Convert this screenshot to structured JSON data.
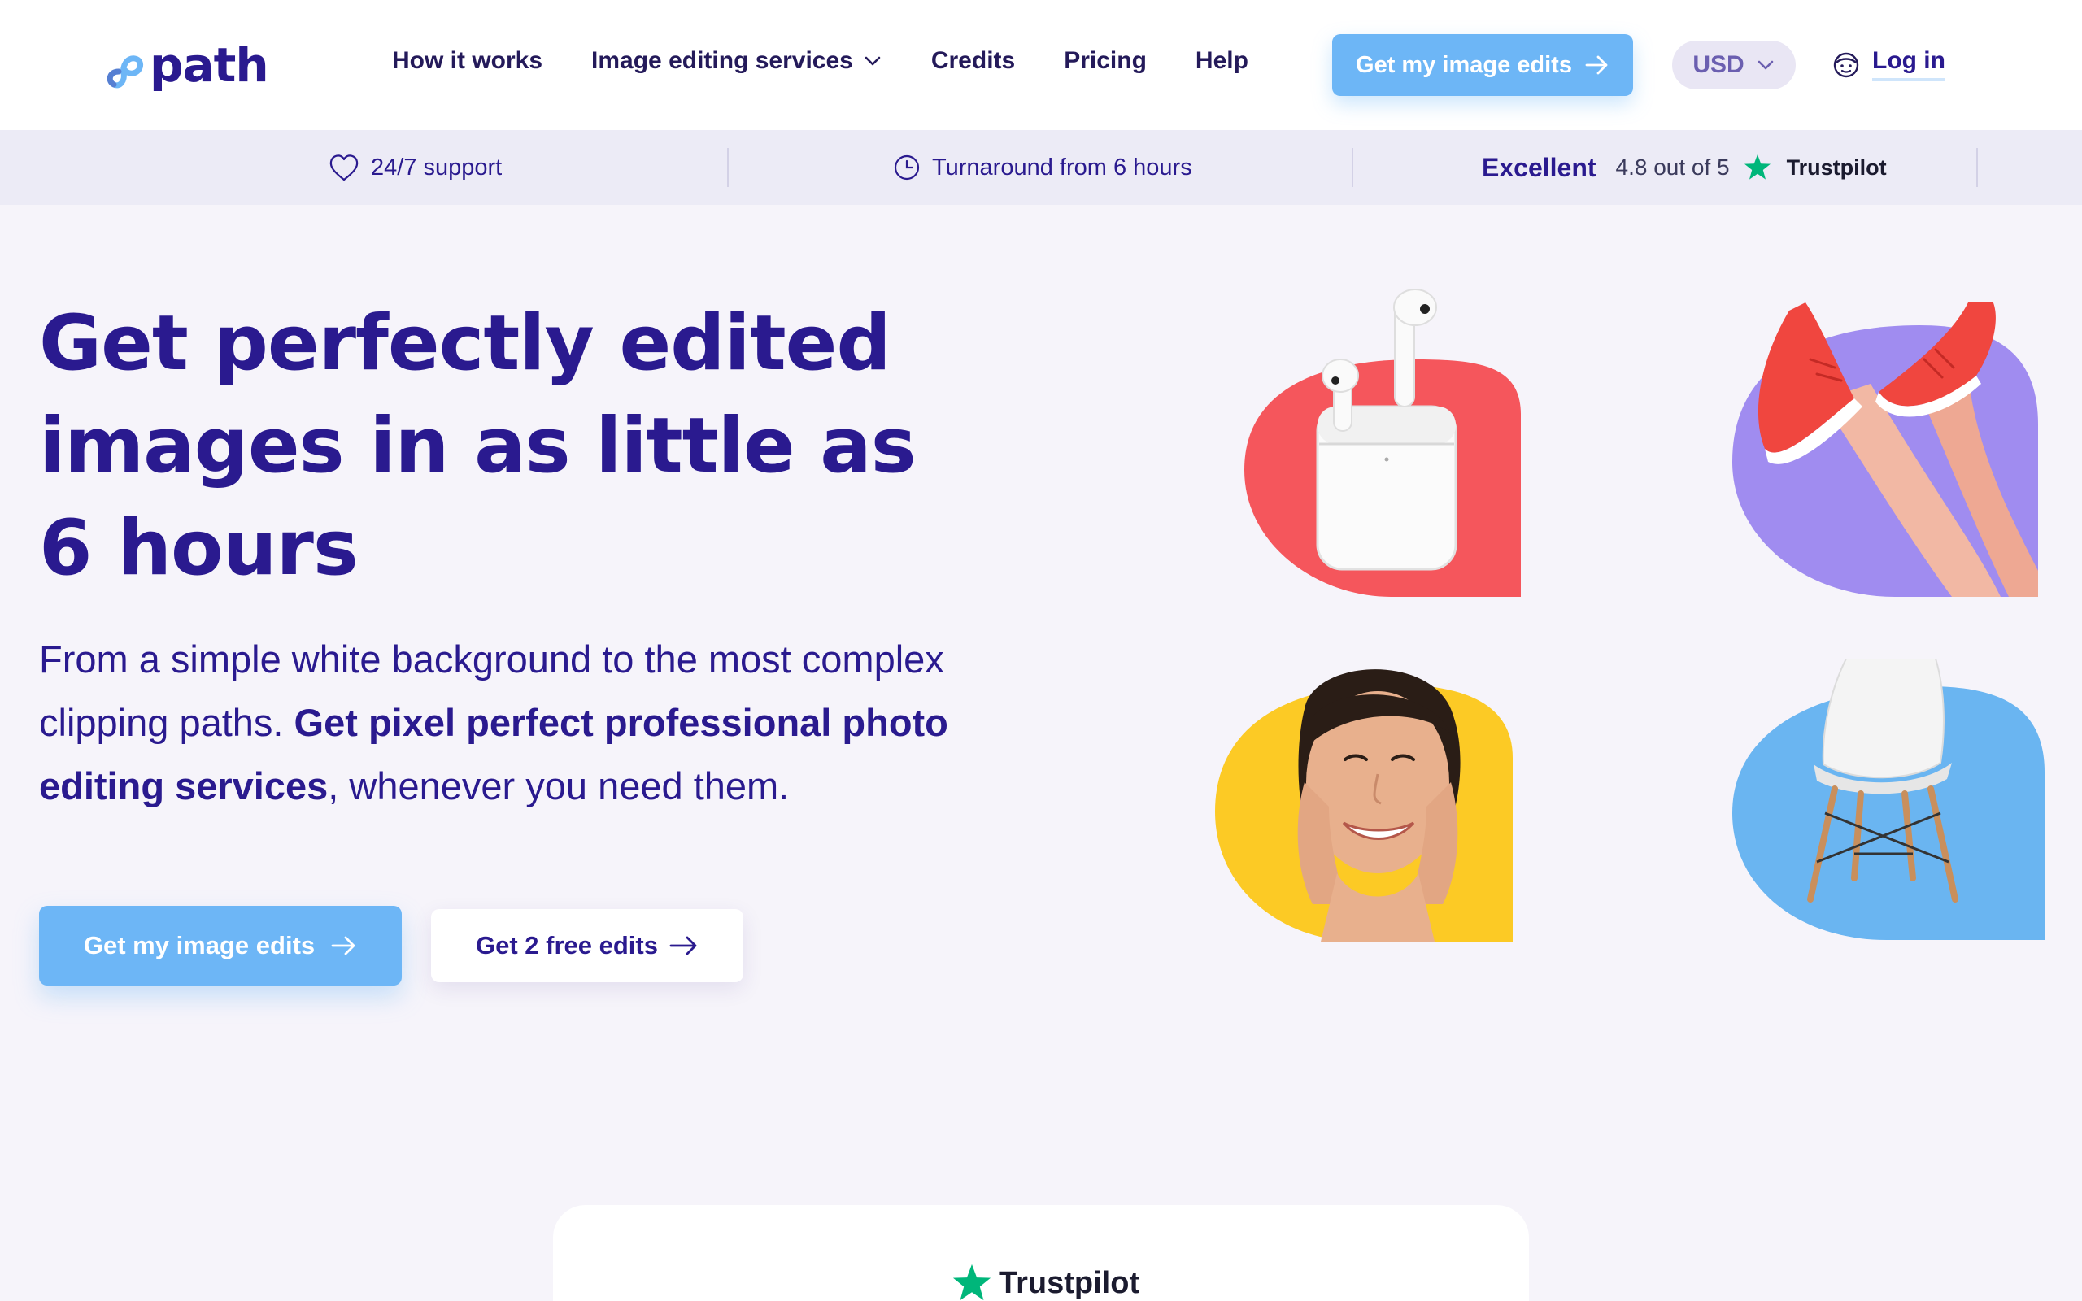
{
  "brand": {
    "name": "path"
  },
  "nav": {
    "items": [
      {
        "label": "How it works"
      },
      {
        "label": "Image editing services",
        "has_dropdown": true
      },
      {
        "label": "Credits"
      },
      {
        "label": "Pricing"
      },
      {
        "label": "Help"
      }
    ]
  },
  "header": {
    "cta_label": "Get my image edits",
    "currency": "USD",
    "login_label": "Log in"
  },
  "trust_strip": {
    "support": "24/7 support",
    "turnaround": "Turnaround from 6 hours",
    "excellent": "Excellent",
    "rating_text": "4.8 out of 5",
    "trustpilot": "Trustpilot"
  },
  "hero": {
    "title": "Get perfectly edited images in as little as 6 hours",
    "subtitle_intro": "From a simple white background to the most complex clipping paths. ",
    "subtitle_bold": "Get pixel perfect professional photo editing services",
    "subtitle_outro": ", whenever you need them.",
    "primary_button": "Get my image edits",
    "secondary_button": "Get 2 free edits"
  },
  "review_card": {
    "brand": "Trustpilot"
  },
  "colors": {
    "brand_navy": "#2a1a8f",
    "accent_blue": "#6db6f6",
    "page_bg": "#f6f4fa",
    "strip_bg": "#ecebf6",
    "trustpilot_green": "#00b67a",
    "tile_red": "#f5565c",
    "tile_purple": "#a08cf0",
    "tile_yellow": "#fcca25",
    "tile_blue": "#6ab5f1"
  }
}
